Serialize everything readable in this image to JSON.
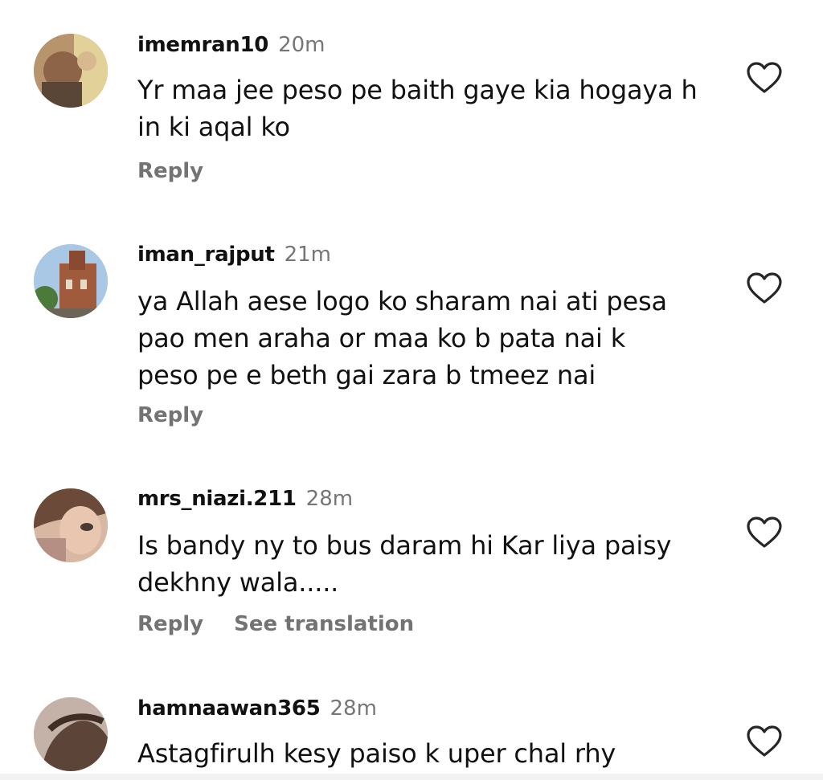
{
  "comments": [
    {
      "username": "imemran10",
      "time": "20m",
      "lines": [
        "Yr maa jee peso pe baith gaye kia hogaya h",
        "in ki aqal ko"
      ],
      "reply_label": "Reply",
      "like_icon": "heart-outline-icon"
    },
    {
      "username": "iman_rajput",
      "time": "21m",
      "lines": [
        "ya Allah aese logo ko sharam nai ati pesa",
        "pao men araha or maa ko b pata nai k",
        "peso pe e beth gai zara b tmeez nai"
      ],
      "reply_label": "Reply",
      "like_icon": "heart-outline-icon"
    },
    {
      "username": "mrs_niazi.211",
      "time": "28m",
      "lines": [
        "Is bandy ny to bus daram hi Kar liya paisy",
        "dekhny wala....."
      ],
      "reply_label": "Reply",
      "see_translation_label": "See translation",
      "like_icon": "heart-outline-icon"
    },
    {
      "username": "hamnaawan365",
      "time": "28m",
      "lines": [
        "Astagfirulh kesy paiso k uper chal rhy"
      ],
      "like_icon": "heart-outline-icon"
    }
  ],
  "colors": {
    "text": "#111111",
    "secondary": "#737373",
    "background": "#ffffff"
  }
}
